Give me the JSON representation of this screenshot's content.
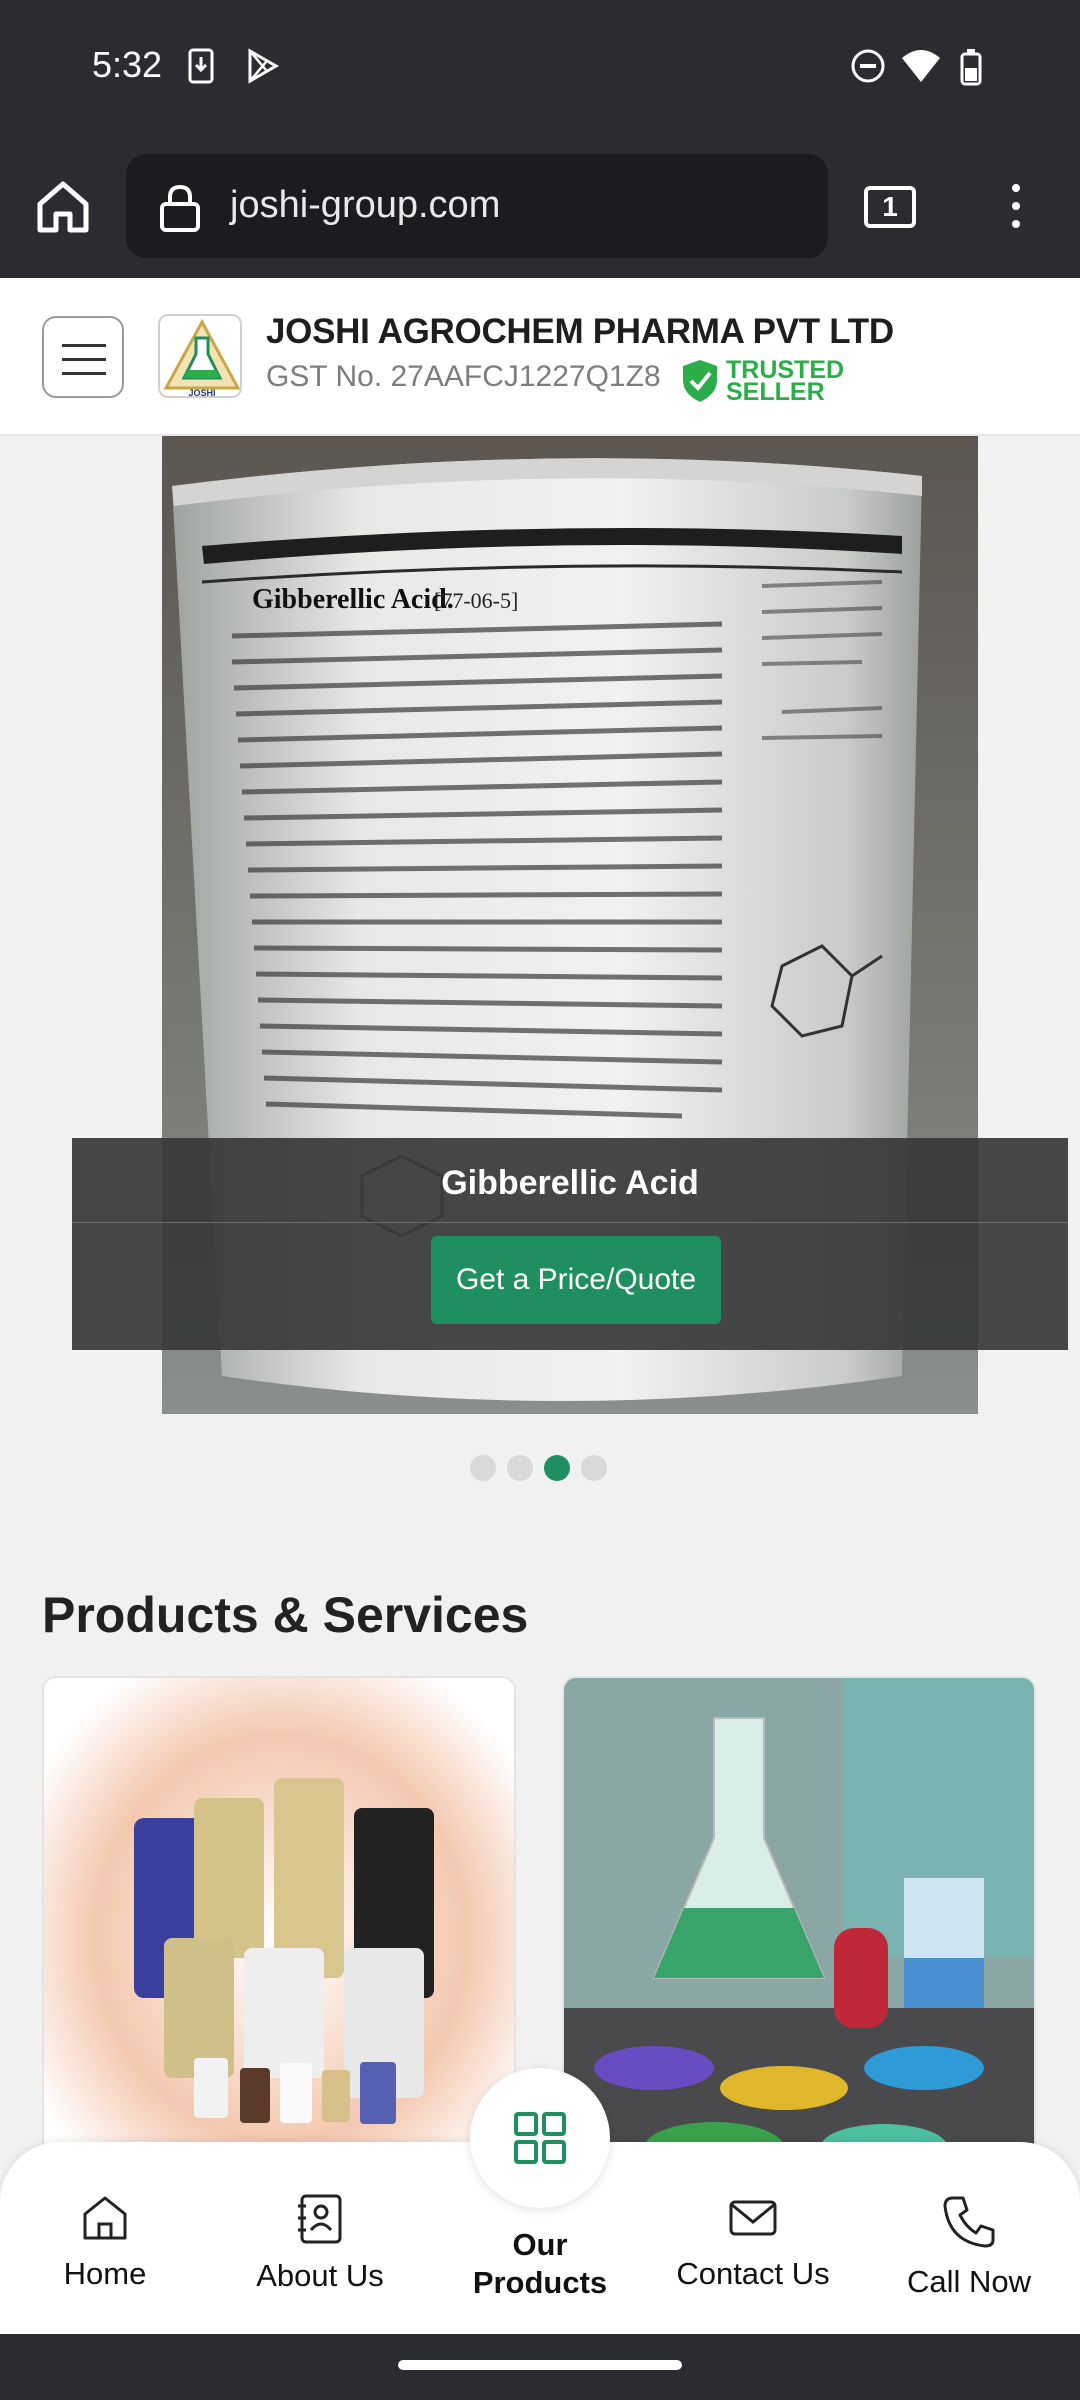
{
  "status_bar": {
    "time": "5:32"
  },
  "browser": {
    "url": "joshi-group.com",
    "tab_count": "1"
  },
  "site_header": {
    "company_name": "JOSHI AGROCHEM PHARMA PVT LTD",
    "gst": "GST No. 27AAFCJ1227Q1Z8",
    "badge_line1": "TRUSTED",
    "badge_line2": "SELLER",
    "logo_text": "JOSHI"
  },
  "carousel": {
    "caption_title": "Gibberellic Acid",
    "cta_label": "Get a Price/Quote",
    "label_title": "Gibberellic Acid.",
    "label_cas": "[77-06-5]",
    "slide_count": 4,
    "active_index": 2
  },
  "products_section": {
    "title": "Products & Services"
  },
  "bottom_nav": {
    "home": "Home",
    "about": "About Us",
    "products_line1": "Our",
    "products_line2": "Products",
    "contact": "Contact Us",
    "call": "Call Now"
  },
  "colors": {
    "accent": "#1f8f5f",
    "trusted_green": "#2bae4a",
    "chrome_dark": "#2b2c30"
  }
}
